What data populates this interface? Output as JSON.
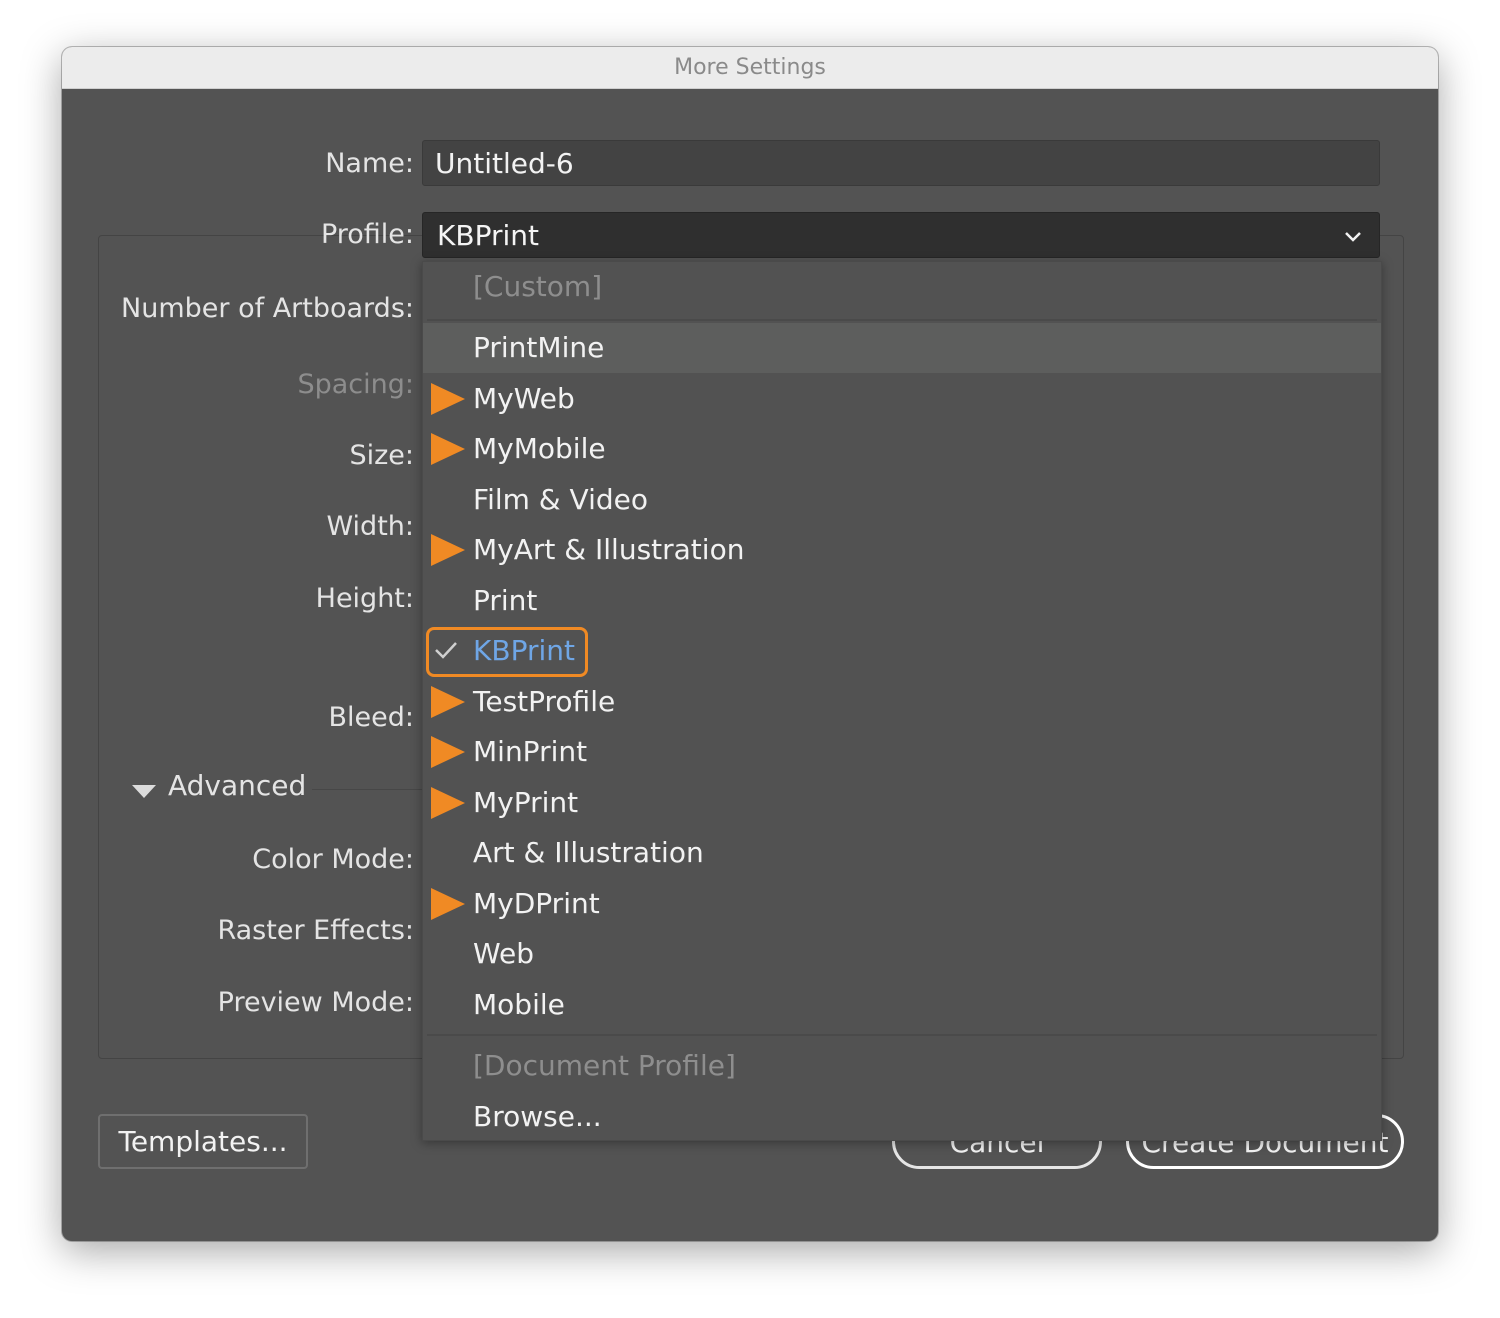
{
  "window": {
    "title": "More Settings"
  },
  "form": {
    "name_label": "Name:",
    "name_value": "Untitled-6",
    "profile_label": "Profile:",
    "profile_value": "KBPrint",
    "artboards_label": "Number of Artboards:",
    "spacing_label": "Spacing:",
    "size_label": "Size:",
    "width_label": "Width:",
    "height_label": "Height:",
    "bleed_label": "Bleed:",
    "advanced_label": "Advanced",
    "color_mode_label": "Color Mode:",
    "raster_label": "Raster Effects:",
    "preview_label": "Preview Mode:"
  },
  "buttons": {
    "templates": "Templates...",
    "cancel": "Cancel",
    "create": "Create Document"
  },
  "menu": {
    "items": [
      {
        "label": "[Custom]",
        "disabled": true
      },
      {
        "label": "PrintMine",
        "hover": true
      },
      {
        "label": "MyWeb",
        "marker": true
      },
      {
        "label": "MyMobile",
        "marker": true
      },
      {
        "label": "Film & Video"
      },
      {
        "label": "MyArt & Illustration",
        "marker": true
      },
      {
        "label": "Print"
      },
      {
        "label": "KBPrint",
        "selected": true,
        "checked": true
      },
      {
        "label": "TestProfile",
        "marker": true
      },
      {
        "label": "MinPrint",
        "marker": true
      },
      {
        "label": "MyPrint",
        "marker": true
      },
      {
        "label": "Art & Illustration"
      },
      {
        "label": "MyDPrint",
        "marker": true
      },
      {
        "label": "Web"
      },
      {
        "label": "Mobile"
      },
      {
        "label": "[Document Profile]",
        "disabled": true
      },
      {
        "label": "Browse..."
      }
    ]
  },
  "colors": {
    "dialog_bg": "#535353",
    "menu_bg": "#525252",
    "marker_orange": "#f08a24",
    "selected_text_blue": "#6fa6e6"
  }
}
